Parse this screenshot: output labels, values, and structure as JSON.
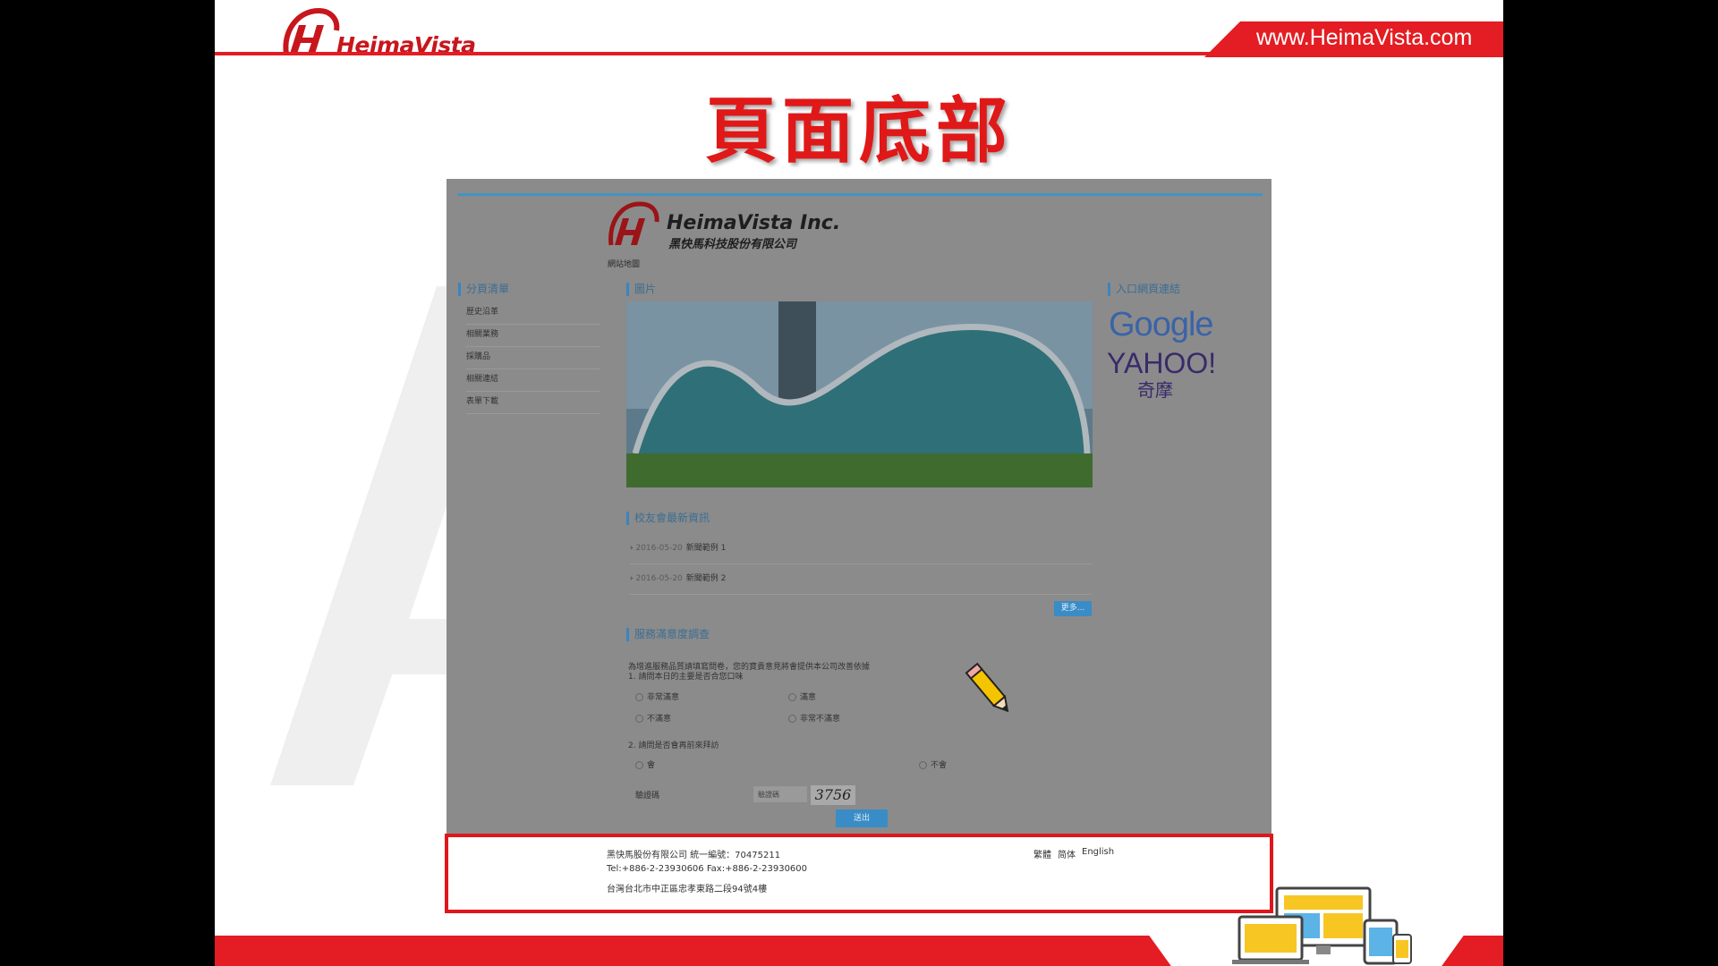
{
  "header": {
    "brand": "HeimaVista",
    "url": "www.HeimaVista.com"
  },
  "slide": {
    "title": "頁面底部"
  },
  "site": {
    "name": "HeimaVista Inc.",
    "name_zh": "黑快馬科技股份有限公司",
    "home_link": "網站地圖",
    "sidebar": {
      "heading": "分頁清單",
      "items": [
        "歷史沿革",
        "相關業務",
        "採購品",
        "相關連結",
        "表單下載"
      ]
    },
    "banner_heading": "圖片",
    "portal_heading": "入口網頁連結",
    "portal_links": {
      "google": "Google",
      "yahoo": "YAHOO!",
      "yahoo_sub": "奇摩"
    },
    "news": {
      "heading": "校友會最新資訊",
      "items": [
        {
          "date": "2016-05-20",
          "title": "新聞範例 1"
        },
        {
          "date": "2016-05-20",
          "title": "新聞範例 2"
        }
      ],
      "more": "更多..."
    },
    "survey": {
      "heading": "服務滿意度調查",
      "intro": "為增進服務品質請填寫問卷，您的寶貴意見將會提供本公司改善依據",
      "q1": "1. 請問本日的主要是否合您口味",
      "q1_options": [
        "非常滿意",
        "滿意",
        "不滿意",
        "非常不滿意"
      ],
      "q2": "2. 請問是否會再前來拜訪",
      "q2_options": [
        "會",
        "不會"
      ],
      "captcha_label": "驗證碼",
      "captcha_placeholder": "驗證碼",
      "captcha_code": "3756",
      "submit": "送出"
    },
    "footer": {
      "company": "黑快馬股份有限公司 統一編號：70475211",
      "tel": "Tel:+886-2-23930606 Fax:+886-2-23930600",
      "address": "台灣台北市中正區忠孝東路二段94號4樓",
      "lang_traditional": "繁體",
      "lang_simplified": "简体",
      "lang_english": "English"
    }
  },
  "colors": {
    "brand_red": "#e31d23",
    "site_blue": "#3a8cc6"
  }
}
